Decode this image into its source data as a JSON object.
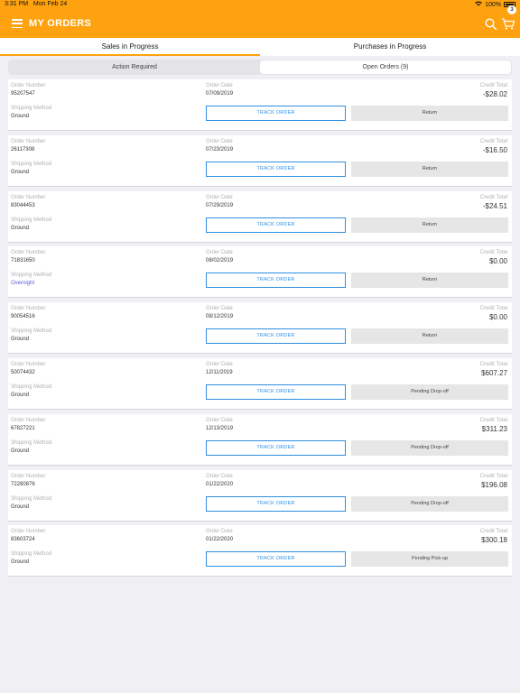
{
  "status_bar": {
    "time": "3:31 PM",
    "date": "Mon Feb 24",
    "battery": "100%"
  },
  "header": {
    "title": "MY ORDERS",
    "cart_count": "3"
  },
  "tabs": [
    {
      "label": "Sales in Progress",
      "active": true
    },
    {
      "label": "Purchases in Progress",
      "active": false
    }
  ],
  "segments": [
    {
      "label": "Action Required",
      "active": false
    },
    {
      "label": "Open Orders (9)",
      "active": true
    }
  ],
  "labels": {
    "order_number": "Order Number",
    "order_date": "Order Date",
    "shipping_method": "Shipping Method",
    "credit_total": "Credit Total",
    "track_order": "TRACK ORDER"
  },
  "orders": [
    {
      "number": "95207547",
      "date": "07/09/2019",
      "shipping": "Ground",
      "credit": "-$28.02",
      "status": "Return"
    },
    {
      "number": "26117308",
      "date": "07/23/2019",
      "shipping": "Ground",
      "credit": "-$16.50",
      "status": "Return"
    },
    {
      "number": "83044453",
      "date": "07/29/2019",
      "shipping": "Ground",
      "credit": "-$24.51",
      "status": "Return"
    },
    {
      "number": "71831650",
      "date": "08/02/2019",
      "shipping": "Overnight",
      "credit": "$0.00",
      "status": "Return"
    },
    {
      "number": "90054516",
      "date": "08/12/2019",
      "shipping": "Ground",
      "credit": "$0.00",
      "status": "Return"
    },
    {
      "number": "50074432",
      "date": "12/11/2019",
      "shipping": "Ground",
      "credit": "$607.27",
      "status": "Pending Drop-off"
    },
    {
      "number": "67827221",
      "date": "12/13/2019",
      "shipping": "Ground",
      "credit": "$311.23",
      "status": "Pending Drop-off"
    },
    {
      "number": "72280876",
      "date": "01/22/2020",
      "shipping": "Ground",
      "credit": "$196.08",
      "status": "Pending Drop-off"
    },
    {
      "number": "83603724",
      "date": "01/22/2020",
      "shipping": "Ground",
      "credit": "$300.18",
      "status": "Pending Pick-up"
    }
  ],
  "colors": {
    "accent": "#ffa20f",
    "link": "#2f8fe0",
    "overnight": "#5b5bd6"
  },
  "icons": [
    "menu-icon",
    "search-icon",
    "cart-icon",
    "wifi-icon",
    "battery-icon"
  ]
}
